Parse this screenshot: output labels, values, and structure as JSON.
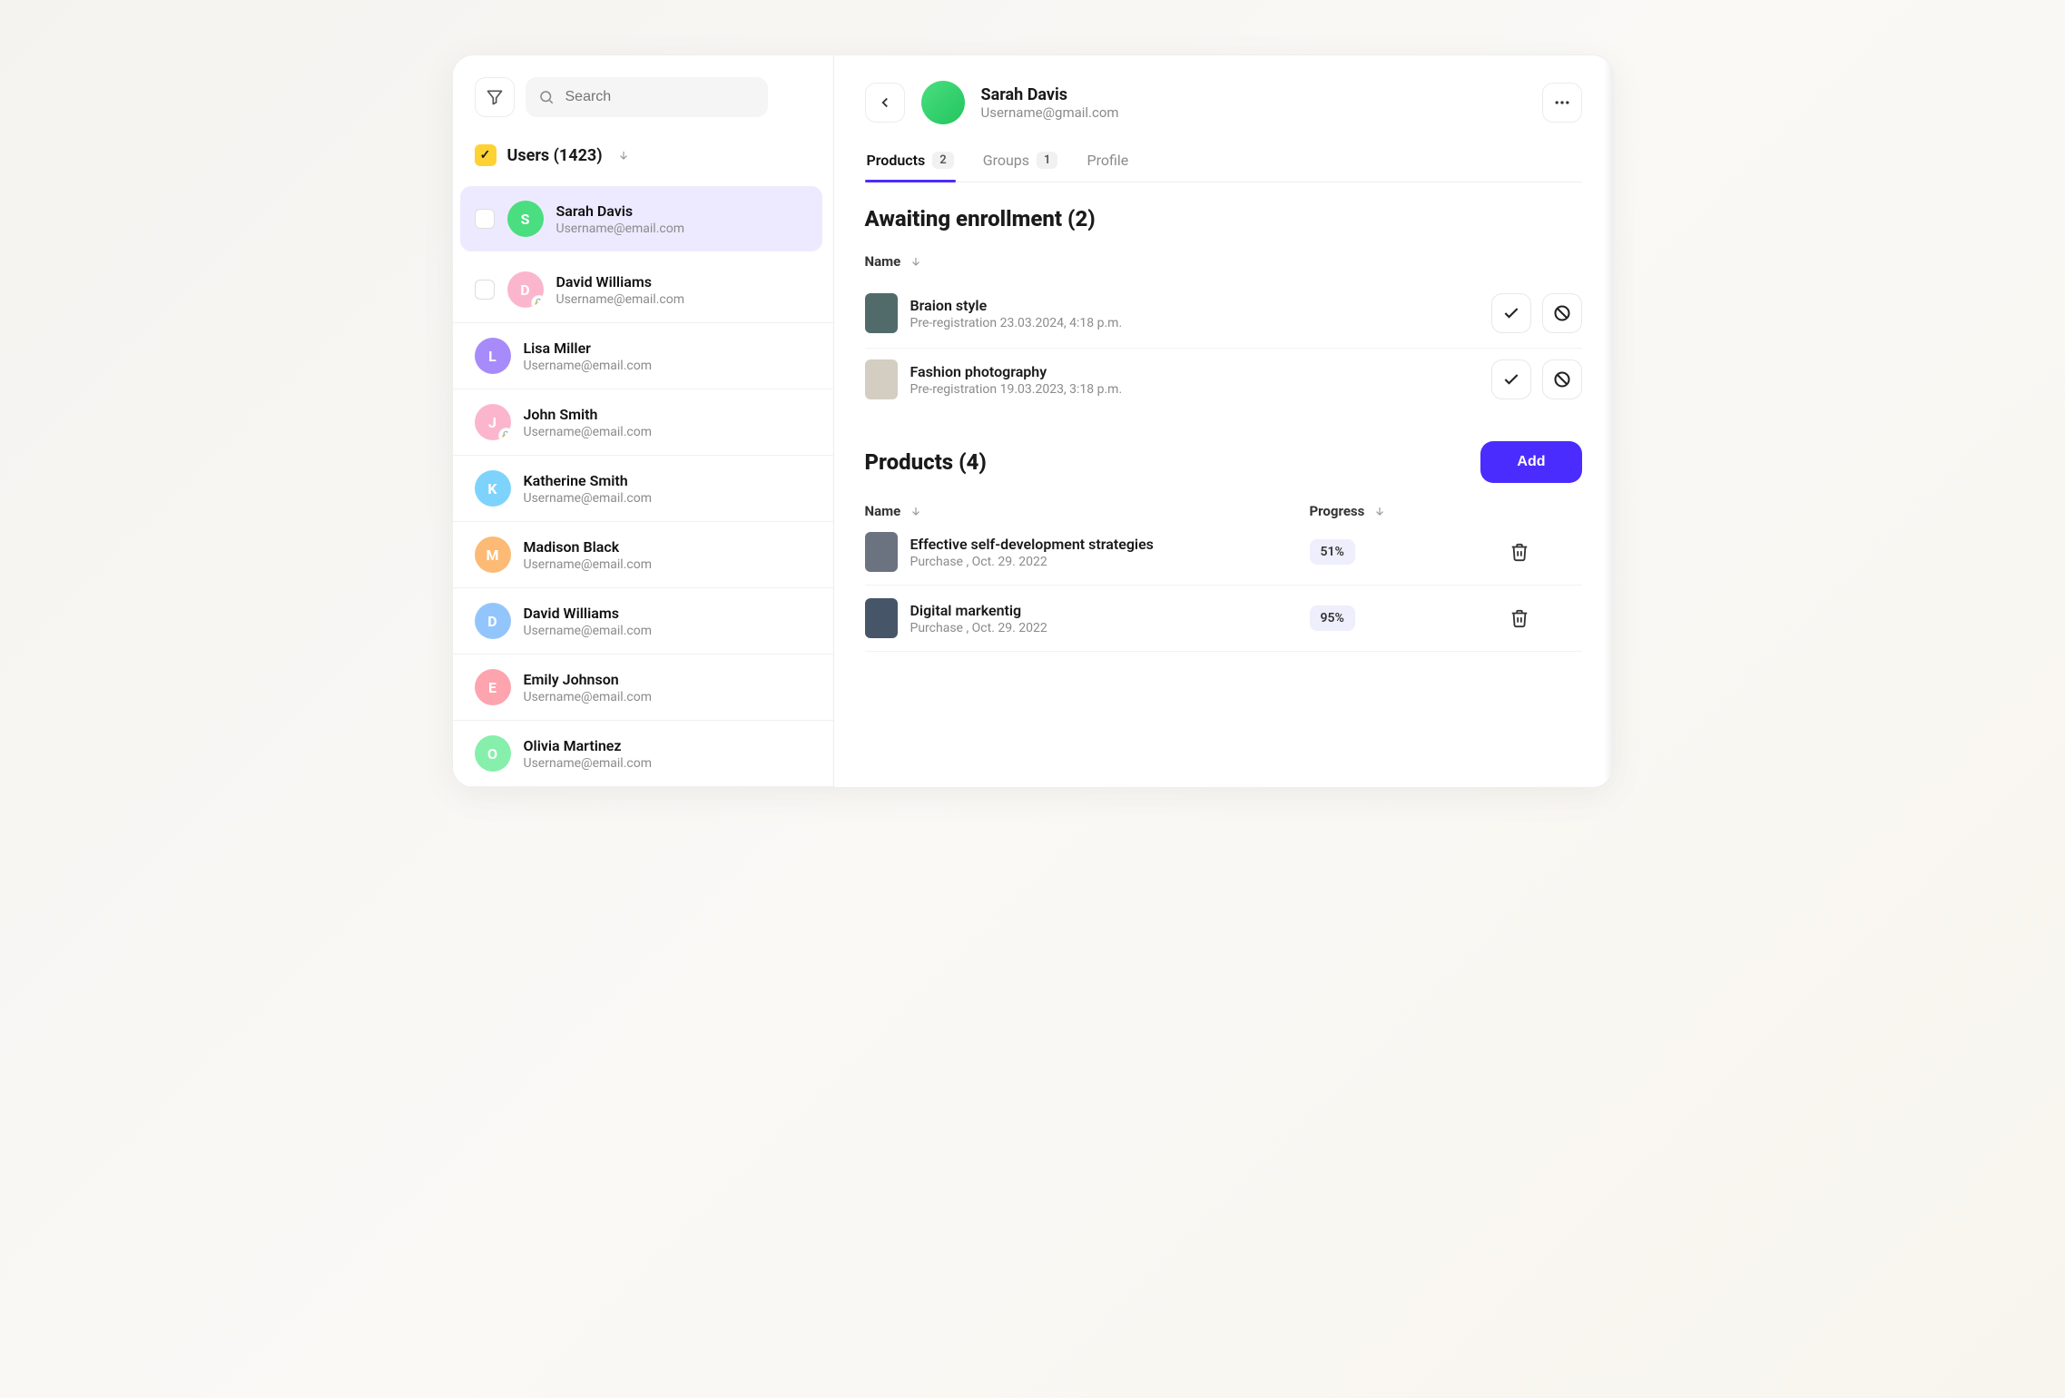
{
  "sidebar": {
    "search_placeholder": "Search",
    "users_header_label": "Users (1423)",
    "users": [
      {
        "name": "Sarah Davis",
        "email": "Username@email.com",
        "initial": "S",
        "color": "#4ade80",
        "selected": true,
        "hasCheckbox": true,
        "locked": false
      },
      {
        "name": "David Williams",
        "email": "Username@email.com",
        "initial": "D",
        "color": "#fbb6ce",
        "selected": false,
        "hasCheckbox": true,
        "locked": true
      },
      {
        "name": "Lisa Miller",
        "email": "Username@email.com",
        "initial": "L",
        "color": "#a78bfa",
        "selected": false,
        "hasCheckbox": false,
        "locked": false
      },
      {
        "name": "John Smith",
        "email": "Username@email.com",
        "initial": "J",
        "color": "#fbb6ce",
        "selected": false,
        "hasCheckbox": false,
        "locked": true
      },
      {
        "name": "Katherine Smith",
        "email": "Username@email.com",
        "initial": "K",
        "color": "#7dd3fc",
        "selected": false,
        "hasCheckbox": false,
        "locked": false
      },
      {
        "name": "Madison Black",
        "email": "Username@email.com",
        "initial": "M",
        "color": "#fdba74",
        "selected": false,
        "hasCheckbox": false,
        "locked": false
      },
      {
        "name": "David Williams",
        "email": "Username@email.com",
        "initial": "D",
        "color": "#93c5fd",
        "selected": false,
        "hasCheckbox": false,
        "locked": false
      },
      {
        "name": "Emily Johnson",
        "email": "Username@email.com",
        "initial": "E",
        "color": "#fda4af",
        "selected": false,
        "hasCheckbox": false,
        "locked": false
      },
      {
        "name": "Olivia Martinez",
        "email": "Username@email.com",
        "initial": "O",
        "color": "#86efac",
        "selected": false,
        "hasCheckbox": false,
        "locked": false
      }
    ]
  },
  "profile": {
    "name": "Sarah Davis",
    "email": "Username@gmail.com",
    "tabs": [
      {
        "label": "Products",
        "count": "2",
        "active": true
      },
      {
        "label": "Groups",
        "count": "1",
        "active": false
      },
      {
        "label": "Profile",
        "count": "",
        "active": false
      }
    ]
  },
  "awaiting": {
    "title": "Awaiting enrollment (2)",
    "name_col": "Name",
    "items": [
      {
        "name": "Braion style",
        "sub": "Pre-registration 23.03.2024, 4:18 p.m.",
        "thumb": "#516b6b"
      },
      {
        "name": "Fashion photography",
        "sub": "Pre-registration 19.03.2023, 3:18 p.m.",
        "thumb": "#d4cec2"
      }
    ]
  },
  "products_section": {
    "title": "Products (4)",
    "add_label": "Add",
    "name_col": "Name",
    "progress_col": "Progress",
    "items": [
      {
        "name": "Effective self-development strategies",
        "sub": "Purchase , Oct. 29. 2022",
        "progress": "51%",
        "thumb": "#6b7280"
      },
      {
        "name": "Digital markentig",
        "sub": "Purchase , Oct. 29. 2022",
        "progress": "95%",
        "thumb": "#475569"
      }
    ]
  }
}
